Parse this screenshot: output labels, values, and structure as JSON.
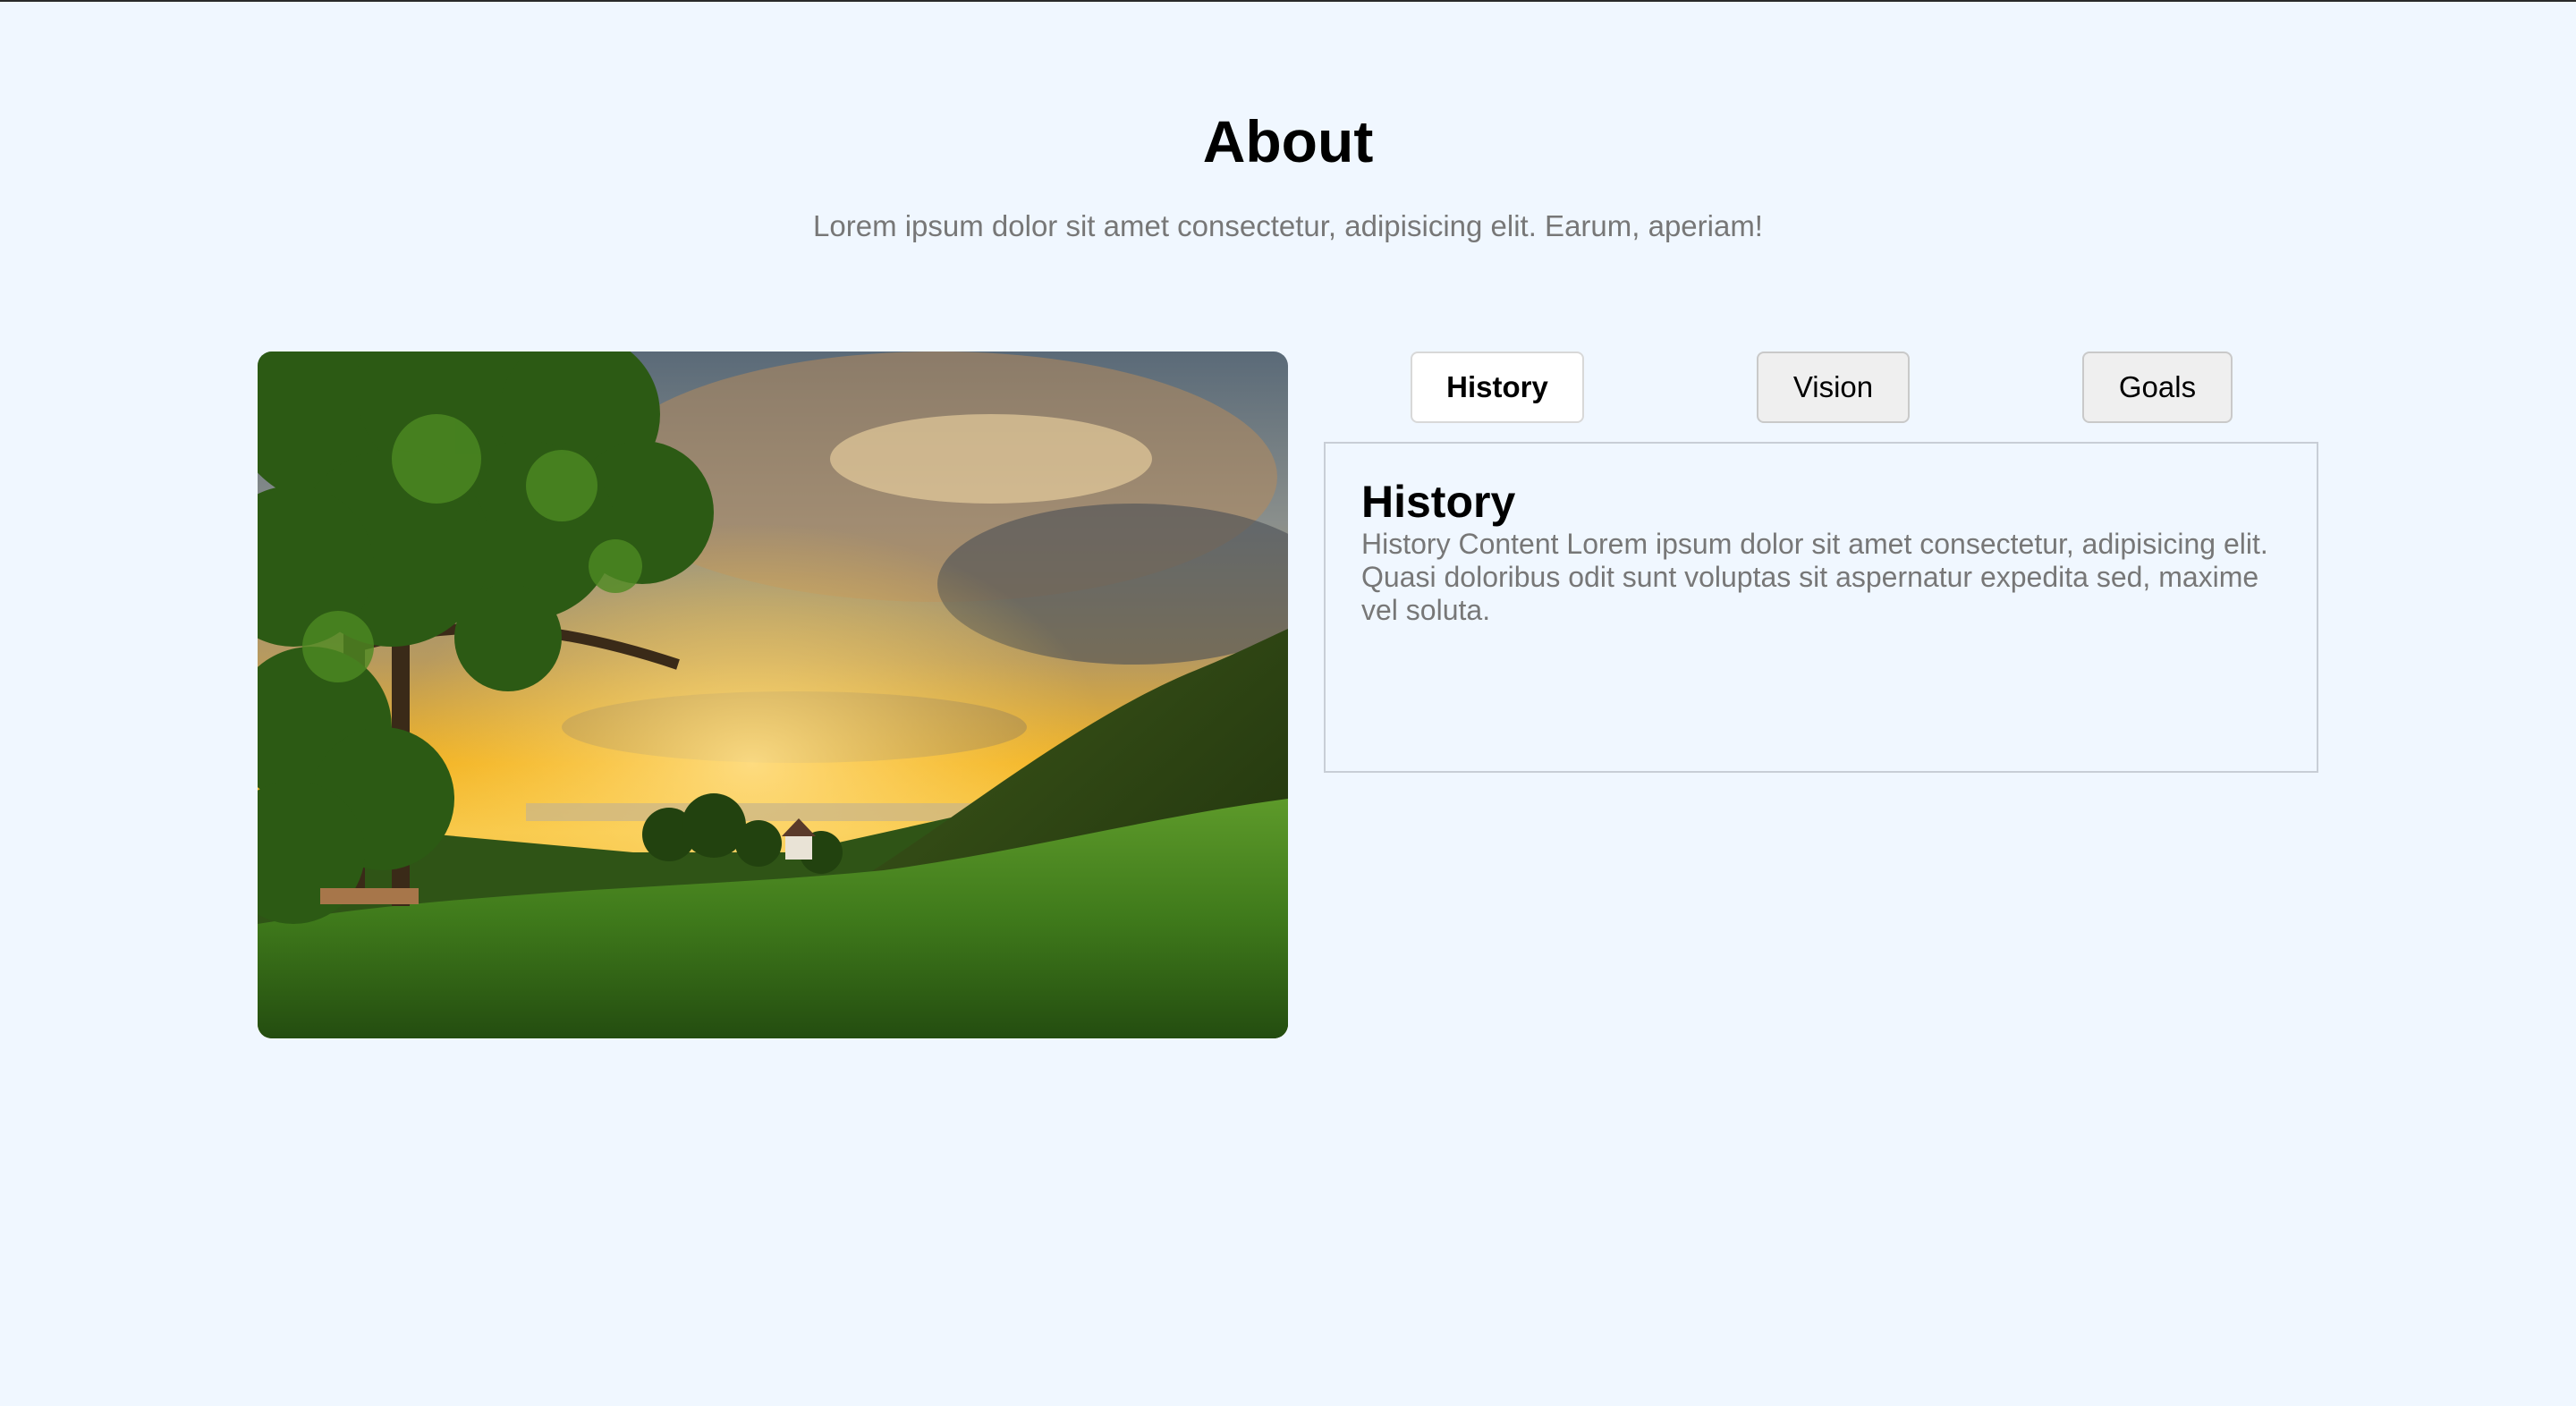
{
  "header": {
    "title": "About",
    "subtitle": "Lorem ipsum dolor sit amet consectetur, adipisicing elit. Earum, aperiam!"
  },
  "image": {
    "subject": "countryside landscape at sunset with tree, green hill and meadow"
  },
  "tabs": [
    {
      "label": "History",
      "active": true
    },
    {
      "label": "Vision",
      "active": false
    },
    {
      "label": "Goals",
      "active": false
    }
  ],
  "panel": {
    "heading": "History",
    "body": "History Content Lorem ipsum dolor sit amet consectetur, adipisicing elit. Quasi doloribus odit sunt voluptas sit aspernatur expedita sed, maxime vel soluta."
  },
  "colors": {
    "background": "#f0f7ff",
    "muted_text": "#777777",
    "panel_border": "#c8ced6",
    "tab_inactive": "#efefef",
    "tab_active": "#ffffff"
  }
}
